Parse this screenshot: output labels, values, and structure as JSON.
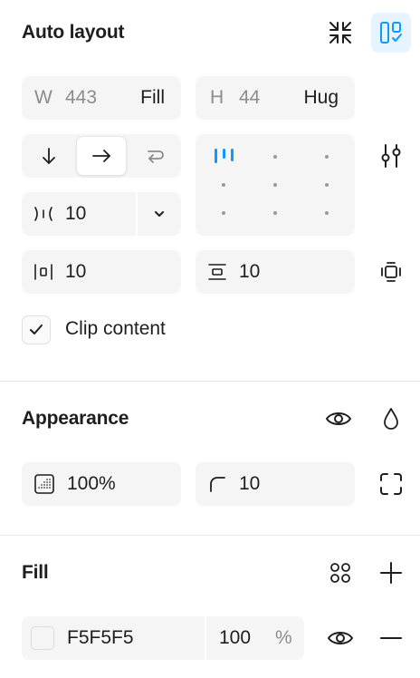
{
  "auto_layout": {
    "title": "Auto layout",
    "width": {
      "label": "W",
      "value": "443",
      "mode": "Fill"
    },
    "height": {
      "label": "H",
      "value": "44",
      "mode": "Hug"
    },
    "gap": {
      "value": "10"
    },
    "horizontal_padding": {
      "value": "10"
    },
    "vertical_padding": {
      "value": "10"
    },
    "clip_content": {
      "label": "Clip content",
      "checked": true
    }
  },
  "appearance": {
    "title": "Appearance",
    "opacity": "100%",
    "corner_radius": "10"
  },
  "fill": {
    "title": "Fill",
    "hex": "F5F5F5",
    "opacity": "100",
    "percent": "%"
  },
  "colors": {
    "accent": "#0d99ff",
    "accent_bg": "#e5f4ff",
    "field_bg": "#f5f5f5",
    "swatch": "#F5F5F5"
  },
  "icons": [
    "collapse-icon",
    "layout-grid-check-icon",
    "arrow-down-icon",
    "arrow-right-icon",
    "wrap-icon",
    "sliders-icon",
    "gap-icon",
    "chevron-down-icon",
    "horizontal-padding-icon",
    "vertical-padding-icon",
    "padding-box-icon",
    "checkmark-icon",
    "eye-icon",
    "droplet-icon",
    "opacity-icon",
    "corner-radius-icon",
    "corners-icon",
    "styles-icon",
    "plus-icon",
    "minus-icon"
  ]
}
